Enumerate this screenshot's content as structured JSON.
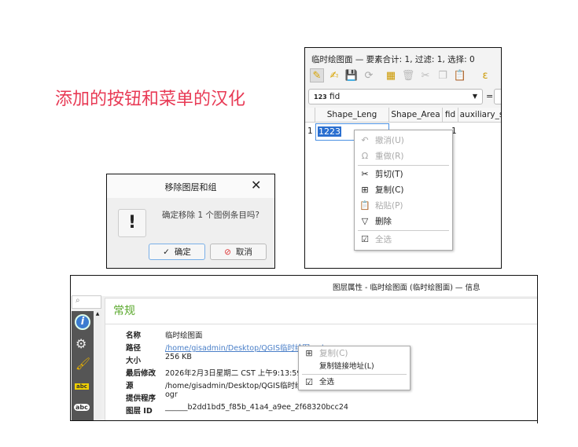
{
  "heading": "添加的按钮和菜单的汉化",
  "attribute_table": {
    "title": "临时绘图面 — 要素合计: 1, 过滤: 1, 选择: 0",
    "field_combo": {
      "type_badge": "123",
      "value": "fid"
    },
    "equals": "=",
    "columns": [
      "Shape_Leng",
      "Shape_Area",
      "fid",
      "auxiliary_s"
    ],
    "row_number": "1",
    "editing_value": "1223",
    "fid_value": "1",
    "context_menu": [
      {
        "icon": "undo-icon",
        "label": "撤消(U)",
        "enabled": false
      },
      {
        "icon": "redo-icon",
        "label": "重做(R)",
        "enabled": false
      },
      {
        "icon": "cut-icon",
        "label": "剪切(T)",
        "enabled": true
      },
      {
        "icon": "copy-icon",
        "label": "复制(C)",
        "enabled": true
      },
      {
        "icon": "paste-icon",
        "label": "粘贴(P)",
        "enabled": false
      },
      {
        "icon": "delete-icon",
        "label": "删除",
        "enabled": true
      },
      {
        "icon": "select-all-icon",
        "label": "全选",
        "enabled": false
      }
    ]
  },
  "dialog": {
    "title": "移除图层和组",
    "message": "确定移除 1 个图例条目吗?",
    "ok": "确定",
    "cancel": "取消"
  },
  "properties": {
    "title": "图层属性 - 临时绘图面 (临时绘图面) — 信息",
    "section": "常规",
    "fields": [
      {
        "label": "名称",
        "value": "临时绘图面"
      },
      {
        "label": "路径",
        "value": "/home/gisadmin/Desktop/QGIS临时绘图.gpkg"
      },
      {
        "label": "大小",
        "value": "256 KB"
      },
      {
        "label": "最后修改",
        "value": "2026年2月3日星期二 CST 上午9:13:59"
      },
      {
        "label": "源",
        "value": "/home/gisadmin/Desktop/QGIS临时绘图.gpkg"
      },
      {
        "label": "提供程序",
        "value": "ogr"
      },
      {
        "label": "图层 ID",
        "value": "______b2dd1bd5_f85b_41a4_a9ee_2f68320bcc24"
      }
    ],
    "context_menu": [
      {
        "icon": "copy-icon",
        "label": "复制(C)",
        "enabled": false
      },
      {
        "icon": "",
        "label": "复制链接地址(L)",
        "enabled": true
      },
      {
        "icon": "select-all-icon",
        "label": "全选",
        "enabled": true
      }
    ],
    "sidebar_icons": [
      "information-icon",
      "source-icon",
      "symbology-icon",
      "labels-icon",
      "masks-icon"
    ],
    "accent": "#5aa82c"
  }
}
